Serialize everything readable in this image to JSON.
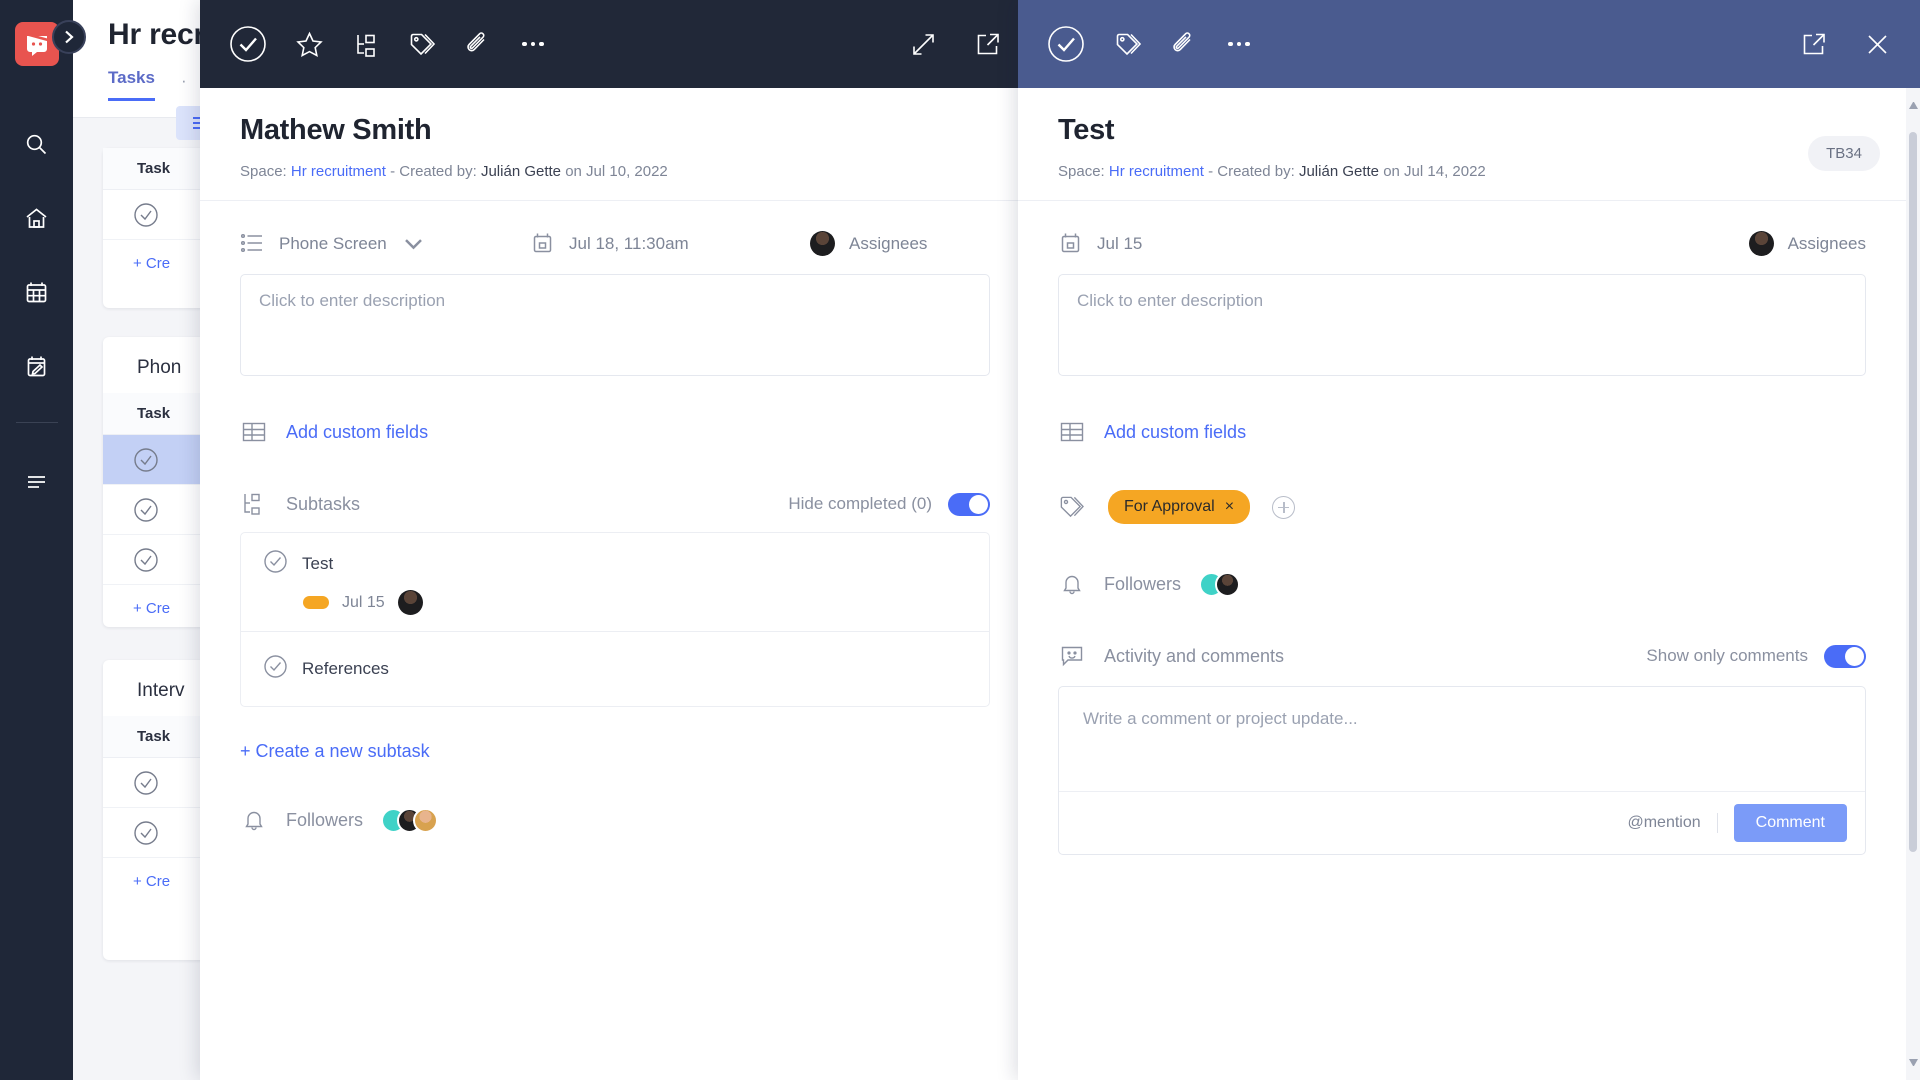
{
  "app": {
    "logo_icon": "app-logo-icon",
    "rail_icons": [
      "search-icon",
      "home-icon",
      "calendar-icon",
      "planner-icon",
      "menu-icon"
    ],
    "sidebar_toggle_icon": "chevron-right-icon"
  },
  "background": {
    "title": "Hr recruitment",
    "tabs": [
      {
        "label": "Tasks"
      },
      {
        "label": "·"
      }
    ],
    "view_label": "List",
    "cards": [
      {
        "title": "",
        "column_header": "Task",
        "rows": [
          {
            "label": ""
          }
        ],
        "create_label": "+ Cre"
      },
      {
        "title": "Phon",
        "column_header": "Task",
        "rows": [
          {
            "label": ""
          },
          {
            "label": ""
          },
          {
            "label": ""
          }
        ],
        "create_label": "+ Cre"
      },
      {
        "title": "Interv",
        "column_header": "Task",
        "rows": [
          {
            "label": ""
          },
          {
            "label": ""
          }
        ],
        "create_label": "+ Cre"
      }
    ]
  },
  "panel_one": {
    "toolbar": {
      "left_icons": [
        "check-circle-icon",
        "star-icon",
        "subtask-icon",
        "tag-icon",
        "paperclip-icon",
        "more-options-icon"
      ],
      "right_icons": [
        "expand-icon",
        "open-external-icon"
      ],
      "bg_color": "#212838"
    },
    "title": "Mathew Smith",
    "meta": {
      "space_label": "Space:",
      "space_name": "Hr recruitment",
      "separator": "- Created by:",
      "creator": "Julián Gette",
      "created_on": "on Jul 10, 2022"
    },
    "status": {
      "icon": "list-icon",
      "label": "Phone Screen",
      "chevron": "chevron-down-icon"
    },
    "due_date": {
      "icon": "calendar-icon",
      "label": "Jul 18, 11:30am"
    },
    "assignees": {
      "icon": "avatar",
      "label": "Assignees"
    },
    "description_placeholder": "Click to enter description",
    "custom_fields": {
      "icon": "table-icon",
      "label": "Add custom fields"
    },
    "subtasks": {
      "icon": "subtask-icon",
      "label": "Subtasks",
      "hide_completed_label": "Hide completed (0)",
      "toggle_on": true,
      "items": [
        {
          "name": "Test",
          "date": "Jul 15",
          "has_tag": true
        },
        {
          "name": "References",
          "date": "",
          "has_tag": false
        }
      ],
      "create_label": "+ Create a new subtask"
    },
    "followers": {
      "icon": "bell-icon",
      "label": "Followers",
      "count": 3
    }
  },
  "panel_two": {
    "toolbar": {
      "left_icons": [
        "check-circle-icon",
        "tag-icon",
        "paperclip-icon",
        "more-options-icon"
      ],
      "right_icons": [
        "open-external-icon",
        "close-icon"
      ],
      "bg_color": "#4a5b8f"
    },
    "title": "Test",
    "meta": {
      "space_label": "Space:",
      "space_name": "Hr recruitment",
      "separator": "- Created by:",
      "creator": "Julián Gette",
      "created_on": "on Jul 14, 2022"
    },
    "code_pill": "TB34",
    "due_date": {
      "icon": "calendar-icon",
      "label": "Jul 15"
    },
    "assignees": {
      "icon": "avatar",
      "label": "Assignees"
    },
    "description_placeholder": "Click to enter description",
    "custom_fields": {
      "icon": "table-icon",
      "label": "Add custom fields"
    },
    "tags": {
      "icon": "tag-icon",
      "chip_label": "For Approval",
      "chip_remove": "×",
      "chip_color": "#f5a623",
      "add_icon": "plus-circle-icon"
    },
    "followers": {
      "icon": "bell-icon",
      "label": "Followers",
      "count": 2
    },
    "activity": {
      "icon": "comment-icon",
      "label": "Activity and comments",
      "show_only_comments_label": "Show only comments",
      "toggle_on": true,
      "comment_placeholder": "Write a comment or project update...",
      "mention_label": "@mention",
      "comment_button": "Comment"
    }
  }
}
